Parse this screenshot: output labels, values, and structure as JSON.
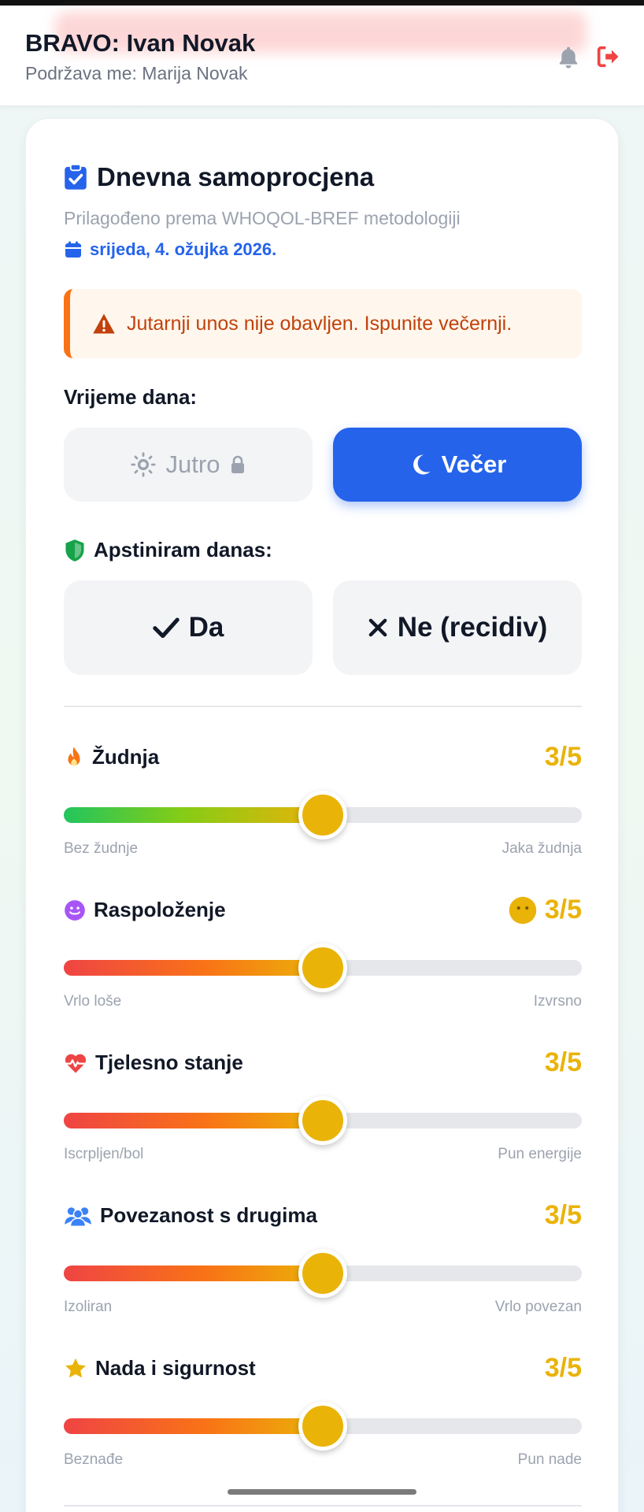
{
  "header": {
    "title": "BRAVO: Ivan Novak",
    "subtitle": "Podržava me: Marija Novak",
    "icons": [
      "bell-icon",
      "logout-icon"
    ]
  },
  "assessment": {
    "title": "Dnevna samoprocjena",
    "subtitle": "Prilagođeno prema WHOQOL-BREF metodologiji",
    "date": "srijeda, 4. ožujka 2026.",
    "alert": "Jutarnji unos nije obavljen. Ispunite večernji.",
    "time_of_day": {
      "label": "Vrijeme dana:",
      "morning": "Jutro",
      "evening": "Večer",
      "selected": "Večer"
    },
    "abstain": {
      "label": "Apstiniram danas:",
      "yes": "Da",
      "no": "Ne (recidiv)"
    },
    "metrics": [
      {
        "name": "Žudnja",
        "value": "3/5",
        "level": 0.5,
        "min_label": "Bez žudnje",
        "max_label": "Jaka žudnja",
        "icon": "fire-icon"
      },
      {
        "name": "Raspoloženje",
        "value": "3/5",
        "level": 0.5,
        "min_label": "Vrlo loše",
        "max_label": "Izvrsno",
        "icon": "smile-icon"
      },
      {
        "name": "Tjelesno stanje",
        "value": "3/5",
        "level": 0.5,
        "min_label": "Iscrpljen/bol",
        "max_label": "Pun energije",
        "icon": "heart-pulse-icon"
      },
      {
        "name": "Povezanost s drugima",
        "value": "3/5",
        "level": 0.5,
        "min_label": "Izoliran",
        "max_label": "Vrlo povezan",
        "icon": "users-icon"
      },
      {
        "name": "Nada i sigurnost",
        "value": "3/5",
        "level": 0.5,
        "min_label": "Beznađe",
        "max_label": "Pun nade",
        "icon": "star-icon"
      }
    ]
  },
  "colors": {
    "accent": "#2563eb",
    "warning": "#f97316",
    "value": "#eab308",
    "danger": "#ef4444"
  }
}
